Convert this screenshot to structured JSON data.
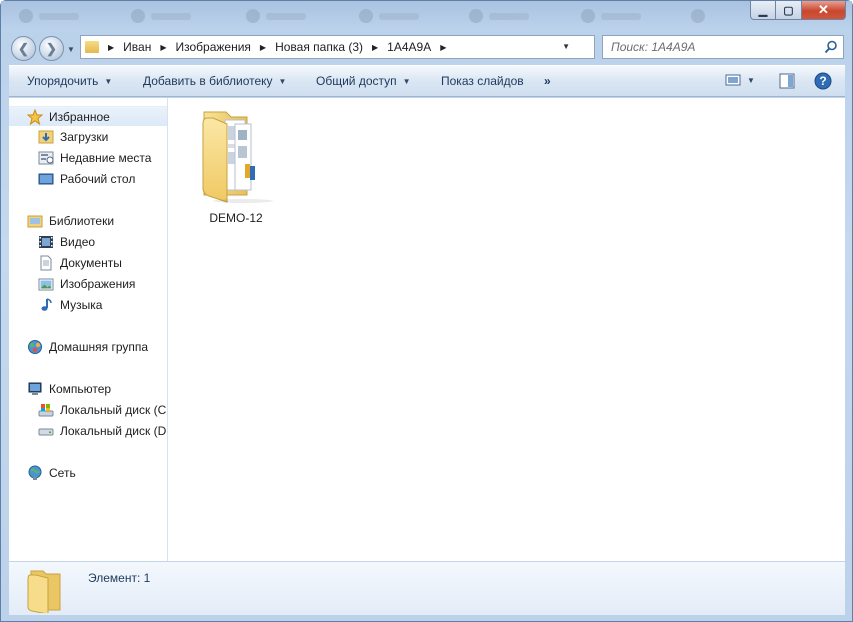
{
  "window": {
    "minimize_label": "▁",
    "maximize_label": "▢",
    "close_label": "✕"
  },
  "breadcrumb": [
    "Иван",
    "Изображения",
    "Новая папка (3)",
    "1A4A9A"
  ],
  "search": {
    "placeholder": "Поиск: 1A4A9A"
  },
  "toolbar": {
    "organize": "Упорядочить",
    "add_to_library": "Добавить в библиотеку",
    "share": "Общий доступ",
    "slideshow": "Показ слайдов",
    "more": "»"
  },
  "nav": {
    "favorites": "Избранное",
    "downloads": "Загрузки",
    "recent": "Недавние места",
    "desktop": "Рабочий стол",
    "libraries": "Библиотеки",
    "video": "Видео",
    "documents": "Документы",
    "pictures": "Изображения",
    "music": "Музыка",
    "homegroup": "Домашняя группа",
    "computer": "Компьютер",
    "disk_c": "Локальный диск (C",
    "disk_d": "Локальный диск (D",
    "network": "Сеть"
  },
  "content": {
    "items": [
      {
        "name": "DEMO-12",
        "type": "folder"
      }
    ]
  },
  "status": {
    "item_count": "Элемент: 1"
  }
}
